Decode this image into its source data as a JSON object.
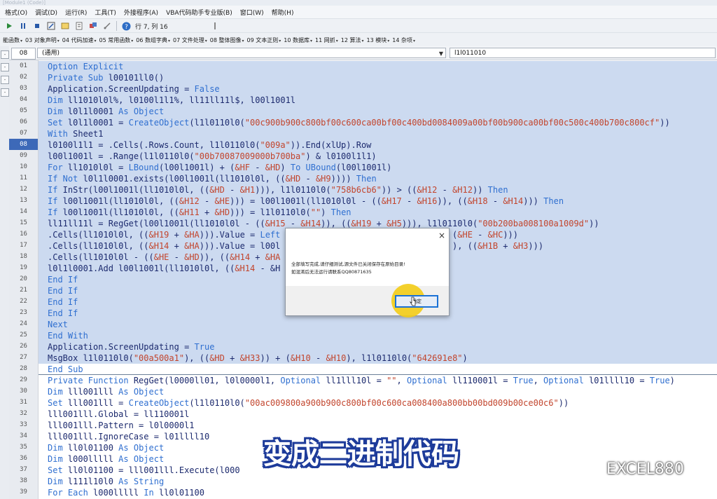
{
  "window": {
    "title": "[Module1 (Code)]"
  },
  "menu": [
    "格式(O)",
    "调试(D)",
    "运行(R)",
    "工具(T)",
    "外接程序(A)",
    "VBA代码助手专业版(B)",
    "窗口(W)",
    "帮助(H)"
  ],
  "toolbar1": {
    "position": "行 7, 列 16"
  },
  "toolbar2": [
    "能函数",
    "03 对象声明",
    "04 代码加速",
    "05 常用函数",
    "06 数组字典",
    "07 文件处理",
    "08 整体图像",
    "09 文本正则",
    "10 数据库",
    "11 网抓",
    "12 算法",
    "13 模块",
    "14 杂项"
  ],
  "editor": {
    "current_line_box": "08",
    "object_combo": "(通用)",
    "procedure_combo": "l1l011010",
    "current_line": "08",
    "lines": [
      {
        "n": "01",
        "t": "Option Explicit"
      },
      {
        "n": "02",
        "t": "Private Sub l00101ll0()"
      },
      {
        "n": "03",
        "t": "Application.ScreenUpdating = False"
      },
      {
        "n": "04",
        "t": "Dim ll1010l0l%, l0100l1l1%, ll11ll11l$, l00l1001l"
      },
      {
        "n": "05",
        "t": "Dim l0l1l0001 As Object"
      },
      {
        "n": "06",
        "t": "Set l0l1l0001 = CreateObject(l1l0110l0(\"00c900b900c800bf00c600ca00bf00c400bd0084009a00bf00b900ca00bf00c500c400b700c800cf\"))"
      },
      {
        "n": "07",
        "t": "With Sheet1"
      },
      {
        "n": "08",
        "t": "l0100l1l1 = .Cells(.Rows.Count, l1l0110l0(\"009a\")).End(xlUp).Row"
      },
      {
        "n": "09",
        "t": "l00l1001l = .Range(l1l0110l0(\"00b70087009000b700ba\") & l0100l1l1)"
      },
      {
        "n": "10",
        "t": "For ll1010l0l = LBound(l00l1001l) + (&HF - &HD) To UBound(l00l1001l)"
      },
      {
        "n": "11",
        "t": "If Not l0l1l0001.exists(l00l1001l(ll1010l0l, ((&HD - &H9)))) Then"
      },
      {
        "n": "12",
        "t": "If InStr(l00l1001l(ll1010l0l, ((&HD - &H1))), l1l0110l0(\"758b6cb6\")) > ((&H12 - &H12)) Then"
      },
      {
        "n": "13",
        "t": "If l00l1001l(ll1010l0l, ((&H12 - &HE))) = l00l1001l(ll1010l0l - ((&H17 - &H16)), ((&H18 - &H14))) Then"
      },
      {
        "n": "14",
        "t": "If l00l1001l(ll1010l0l, ((&H11 + &HD))) = l1l0110l0(\"\") Then"
      },
      {
        "n": "15",
        "t": "ll11ll11l = RegGet(l00l1001l(ll1010l0l - ((&H15 - &H14)), ((&H19 + &H5))), l1l0110l0(\"00b200ba008100a1009d\"))"
      },
      {
        "n": "16",
        "t": ".Cells(ll1010l0l, ((&H19 + &HA))).Value = Left                                  (&HE - &HC)))"
      },
      {
        "n": "17",
        "t": ".Cells(ll1010l0l, ((&H14 + &HA))).Value = l00l                                  ), ((&H1B + &H3)))"
      },
      {
        "n": "18",
        "t": ".Cells(ll1010l0l - ((&HE - &HD)), ((&H14 + &HA"
      },
      {
        "n": "19",
        "t": "l0l1l0001.Add l00l1001l(ll1010l0l, ((&H14 - &H"
      },
      {
        "n": "20",
        "t": "End If"
      },
      {
        "n": "21",
        "t": "End If"
      },
      {
        "n": "22",
        "t": "End If"
      },
      {
        "n": "23",
        "t": "End If"
      },
      {
        "n": "24",
        "t": "Next"
      },
      {
        "n": "25",
        "t": "End With"
      },
      {
        "n": "26",
        "t": "Application.ScreenUpdating = True"
      },
      {
        "n": "27",
        "t": "MsgBox l1l0110l0(\"00a500a1\"), ((&HD + &H33)) + (&H10 - &H10), l1l0110l0(\"642691e8\")"
      },
      {
        "n": "28",
        "t": "End Sub"
      },
      {
        "n": "29",
        "t": "Private Function RegGet(l0000ll01, l0l0000l1, Optional ll1lll10l = \"\", Optional ll110001l = True, Optional l01llll10 = True)"
      },
      {
        "n": "30",
        "t": "Dim lll001lll As Object"
      },
      {
        "n": "31",
        "t": "Set lll001lll = CreateObject(l1l0110l0(\"00ac009800a900b900c800bf00c600ca008400a800bb00bd009b00ce00c6\"))"
      },
      {
        "n": "32",
        "t": "lll001lll.Global = ll110001l"
      },
      {
        "n": "33",
        "t": "lll001lll.Pattern = l0l0000l1"
      },
      {
        "n": "34",
        "t": "lll001lll.IgnoreCase = l01llll10"
      },
      {
        "n": "35",
        "t": "Dim ll0l01100 As Object"
      },
      {
        "n": "36",
        "t": "Dim l000lllll As Object"
      },
      {
        "n": "37",
        "t": "Set ll0l01100 = lll001lll.Execute(l000"
      },
      {
        "n": "38",
        "t": "Dim l111l10l0 As String"
      },
      {
        "n": "39",
        "t": "For Each l000lllll In ll0l01100"
      }
    ]
  },
  "dialog": {
    "close": "×",
    "message_line1": "全部填写完成,请仔细测试,源文件已关闭保存在原始目录!",
    "message_line2": "如混淆后无法运行请联系QQ80871635",
    "ok_label": "确定"
  },
  "overlay": {
    "caption": "变成二进制代码",
    "watermark": "EXCEL880"
  },
  "colors": {
    "keyword": "#2f6fd0",
    "string_hex": "#c2452d",
    "highlight": "#f3cc16",
    "current_line_number_bg": "#3d69b8"
  }
}
